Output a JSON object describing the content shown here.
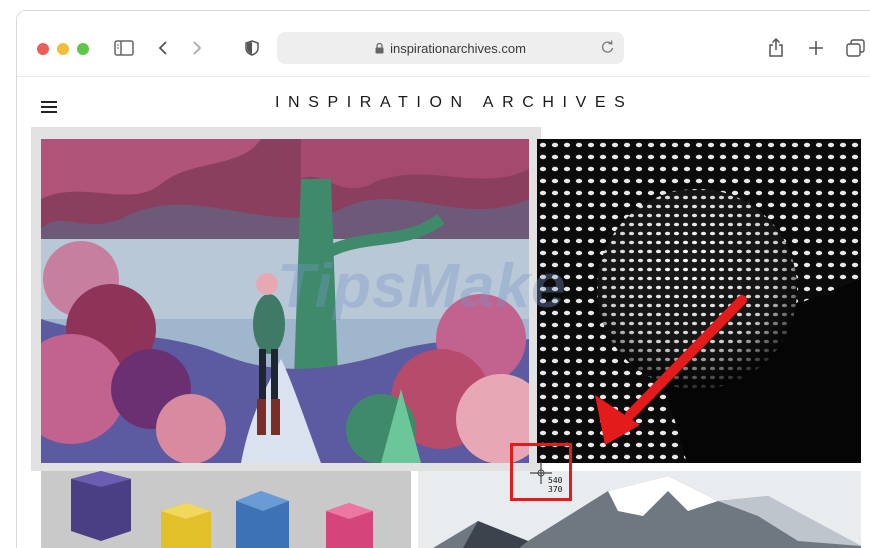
{
  "browser": {
    "url": "inspirationarchives.com",
    "icons": {
      "sidebar": "sidebar-icon",
      "back": "chevron-left-icon",
      "forward": "chevron-right-icon",
      "privacy": "shield-icon",
      "lock": "lock-icon",
      "reload": "reload-icon",
      "share": "share-icon",
      "new_tab": "plus-icon",
      "tabs": "tabs-overview-icon"
    }
  },
  "site": {
    "title": "INSPIRATION ARCHIVES",
    "menu_icon": "hamburger-menu-icon"
  },
  "gallery": {
    "images": [
      {
        "name": "forest-illustration"
      },
      {
        "name": "halftone-sphere"
      },
      {
        "name": "colored-cubes"
      },
      {
        "name": "snowy-mountain"
      }
    ]
  },
  "overlay": {
    "watermark": "TipsMake",
    "pointer_x": "540",
    "pointer_y": "370",
    "colors": {
      "highlight": "#e31b1b"
    }
  }
}
